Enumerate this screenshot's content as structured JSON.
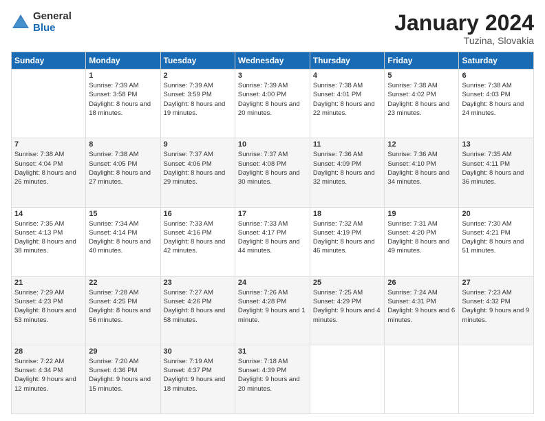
{
  "header": {
    "logo_general": "General",
    "logo_blue": "Blue",
    "month_title": "January 2024",
    "subtitle": "Tuzina, Slovakia"
  },
  "weekdays": [
    "Sunday",
    "Monday",
    "Tuesday",
    "Wednesday",
    "Thursday",
    "Friday",
    "Saturday"
  ],
  "weeks": [
    [
      {
        "day": "",
        "sunrise": "",
        "sunset": "",
        "daylight": ""
      },
      {
        "day": "1",
        "sunrise": "Sunrise: 7:39 AM",
        "sunset": "Sunset: 3:58 PM",
        "daylight": "Daylight: 8 hours and 18 minutes."
      },
      {
        "day": "2",
        "sunrise": "Sunrise: 7:39 AM",
        "sunset": "Sunset: 3:59 PM",
        "daylight": "Daylight: 8 hours and 19 minutes."
      },
      {
        "day": "3",
        "sunrise": "Sunrise: 7:39 AM",
        "sunset": "Sunset: 4:00 PM",
        "daylight": "Daylight: 8 hours and 20 minutes."
      },
      {
        "day": "4",
        "sunrise": "Sunrise: 7:38 AM",
        "sunset": "Sunset: 4:01 PM",
        "daylight": "Daylight: 8 hours and 22 minutes."
      },
      {
        "day": "5",
        "sunrise": "Sunrise: 7:38 AM",
        "sunset": "Sunset: 4:02 PM",
        "daylight": "Daylight: 8 hours and 23 minutes."
      },
      {
        "day": "6",
        "sunrise": "Sunrise: 7:38 AM",
        "sunset": "Sunset: 4:03 PM",
        "daylight": "Daylight: 8 hours and 24 minutes."
      }
    ],
    [
      {
        "day": "7",
        "sunrise": "Sunrise: 7:38 AM",
        "sunset": "Sunset: 4:04 PM",
        "daylight": "Daylight: 8 hours and 26 minutes."
      },
      {
        "day": "8",
        "sunrise": "Sunrise: 7:38 AM",
        "sunset": "Sunset: 4:05 PM",
        "daylight": "Daylight: 8 hours and 27 minutes."
      },
      {
        "day": "9",
        "sunrise": "Sunrise: 7:37 AM",
        "sunset": "Sunset: 4:06 PM",
        "daylight": "Daylight: 8 hours and 29 minutes."
      },
      {
        "day": "10",
        "sunrise": "Sunrise: 7:37 AM",
        "sunset": "Sunset: 4:08 PM",
        "daylight": "Daylight: 8 hours and 30 minutes."
      },
      {
        "day": "11",
        "sunrise": "Sunrise: 7:36 AM",
        "sunset": "Sunset: 4:09 PM",
        "daylight": "Daylight: 8 hours and 32 minutes."
      },
      {
        "day": "12",
        "sunrise": "Sunrise: 7:36 AM",
        "sunset": "Sunset: 4:10 PM",
        "daylight": "Daylight: 8 hours and 34 minutes."
      },
      {
        "day": "13",
        "sunrise": "Sunrise: 7:35 AM",
        "sunset": "Sunset: 4:11 PM",
        "daylight": "Daylight: 8 hours and 36 minutes."
      }
    ],
    [
      {
        "day": "14",
        "sunrise": "Sunrise: 7:35 AM",
        "sunset": "Sunset: 4:13 PM",
        "daylight": "Daylight: 8 hours and 38 minutes."
      },
      {
        "day": "15",
        "sunrise": "Sunrise: 7:34 AM",
        "sunset": "Sunset: 4:14 PM",
        "daylight": "Daylight: 8 hours and 40 minutes."
      },
      {
        "day": "16",
        "sunrise": "Sunrise: 7:33 AM",
        "sunset": "Sunset: 4:16 PM",
        "daylight": "Daylight: 8 hours and 42 minutes."
      },
      {
        "day": "17",
        "sunrise": "Sunrise: 7:33 AM",
        "sunset": "Sunset: 4:17 PM",
        "daylight": "Daylight: 8 hours and 44 minutes."
      },
      {
        "day": "18",
        "sunrise": "Sunrise: 7:32 AM",
        "sunset": "Sunset: 4:19 PM",
        "daylight": "Daylight: 8 hours and 46 minutes."
      },
      {
        "day": "19",
        "sunrise": "Sunrise: 7:31 AM",
        "sunset": "Sunset: 4:20 PM",
        "daylight": "Daylight: 8 hours and 49 minutes."
      },
      {
        "day": "20",
        "sunrise": "Sunrise: 7:30 AM",
        "sunset": "Sunset: 4:21 PM",
        "daylight": "Daylight: 8 hours and 51 minutes."
      }
    ],
    [
      {
        "day": "21",
        "sunrise": "Sunrise: 7:29 AM",
        "sunset": "Sunset: 4:23 PM",
        "daylight": "Daylight: 8 hours and 53 minutes."
      },
      {
        "day": "22",
        "sunrise": "Sunrise: 7:28 AM",
        "sunset": "Sunset: 4:25 PM",
        "daylight": "Daylight: 8 hours and 56 minutes."
      },
      {
        "day": "23",
        "sunrise": "Sunrise: 7:27 AM",
        "sunset": "Sunset: 4:26 PM",
        "daylight": "Daylight: 8 hours and 58 minutes."
      },
      {
        "day": "24",
        "sunrise": "Sunrise: 7:26 AM",
        "sunset": "Sunset: 4:28 PM",
        "daylight": "Daylight: 9 hours and 1 minute."
      },
      {
        "day": "25",
        "sunrise": "Sunrise: 7:25 AM",
        "sunset": "Sunset: 4:29 PM",
        "daylight": "Daylight: 9 hours and 4 minutes."
      },
      {
        "day": "26",
        "sunrise": "Sunrise: 7:24 AM",
        "sunset": "Sunset: 4:31 PM",
        "daylight": "Daylight: 9 hours and 6 minutes."
      },
      {
        "day": "27",
        "sunrise": "Sunrise: 7:23 AM",
        "sunset": "Sunset: 4:32 PM",
        "daylight": "Daylight: 9 hours and 9 minutes."
      }
    ],
    [
      {
        "day": "28",
        "sunrise": "Sunrise: 7:22 AM",
        "sunset": "Sunset: 4:34 PM",
        "daylight": "Daylight: 9 hours and 12 minutes."
      },
      {
        "day": "29",
        "sunrise": "Sunrise: 7:20 AM",
        "sunset": "Sunset: 4:36 PM",
        "daylight": "Daylight: 9 hours and 15 minutes."
      },
      {
        "day": "30",
        "sunrise": "Sunrise: 7:19 AM",
        "sunset": "Sunset: 4:37 PM",
        "daylight": "Daylight: 9 hours and 18 minutes."
      },
      {
        "day": "31",
        "sunrise": "Sunrise: 7:18 AM",
        "sunset": "Sunset: 4:39 PM",
        "daylight": "Daylight: 9 hours and 20 minutes."
      },
      {
        "day": "",
        "sunrise": "",
        "sunset": "",
        "daylight": ""
      },
      {
        "day": "",
        "sunrise": "",
        "sunset": "",
        "daylight": ""
      },
      {
        "day": "",
        "sunrise": "",
        "sunset": "",
        "daylight": ""
      }
    ]
  ]
}
